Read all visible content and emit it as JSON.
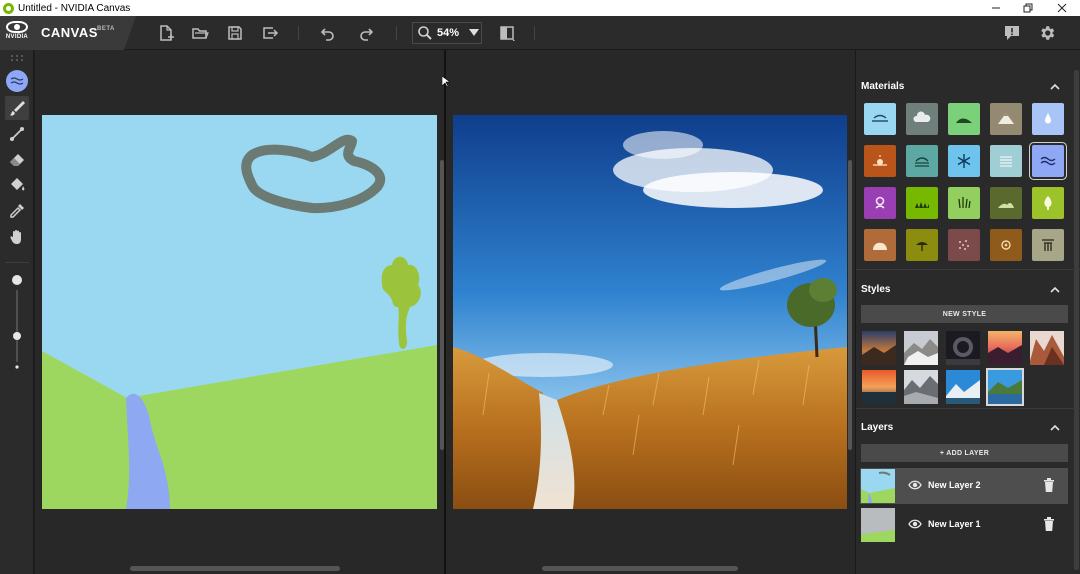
{
  "window": {
    "title": "Untitled - NVIDIA Canvas"
  },
  "brand": {
    "vendor": "NVIDIA",
    "name": "CANVAS",
    "badge": "BETA"
  },
  "toolbar": {
    "zoom_value": "54%",
    "buttons": [
      "new-file-icon",
      "open-folder-icon",
      "save-icon",
      "export-icon",
      "undo-icon",
      "redo-icon"
    ]
  },
  "tools": [
    "paint-bucket-fill-icon",
    "brush-icon",
    "line-icon",
    "eraser-icon",
    "fill-icon",
    "eyedropper-icon",
    "hand-icon"
  ],
  "brush": {
    "size_fraction": 0.25
  },
  "colors": {
    "accent": "#76b900",
    "selected_material": "#8fa8f5",
    "sky": "#9ad8f2",
    "grass": "#9ed75f",
    "river": "#8ea8f2",
    "cloud": "#6b7a72",
    "tree": "#9bc43c"
  },
  "materials": {
    "title": "Materials",
    "items": [
      {
        "name": "sky",
        "color": "#9ad8f2"
      },
      {
        "name": "cloud",
        "color": "#6e7f7c"
      },
      {
        "name": "grass-hill",
        "color": "#7bd07a"
      },
      {
        "name": "mountain",
        "color": "#948a72"
      },
      {
        "name": "water",
        "color": "#a9c4f7"
      },
      {
        "name": "sunset",
        "color": "#b9541b"
      },
      {
        "name": "fog",
        "color": "#5ea8a4"
      },
      {
        "name": "snow",
        "color": "#6ec4ec"
      },
      {
        "name": "sea",
        "color": "#9fcfd4"
      },
      {
        "name": "river",
        "color": "#8fa8f5"
      },
      {
        "name": "flower",
        "color": "#9a3fb3"
      },
      {
        "name": "grass",
        "color": "#76b900"
      },
      {
        "name": "tall-grass",
        "color": "#93cf5e"
      },
      {
        "name": "hill",
        "color": "#5a6a2f"
      },
      {
        "name": "tree",
        "color": "#9cc32a"
      },
      {
        "name": "rock",
        "color": "#b06b3a"
      },
      {
        "name": "beach",
        "color": "#8c8c0f"
      },
      {
        "name": "gravel",
        "color": "#7c4a4a"
      },
      {
        "name": "dirt",
        "color": "#8f5b1c"
      },
      {
        "name": "building",
        "color": "#a8a688"
      }
    ],
    "selected_index": 9
  },
  "styles": {
    "title": "Styles",
    "new_style_label": "NEW STYLE",
    "selected_index": 8
  },
  "layers": {
    "title": "Layers",
    "add_label": "+ ADD LAYER",
    "items": [
      {
        "name": "New Layer 2",
        "active": true
      },
      {
        "name": "New Layer 1",
        "active": false
      }
    ]
  }
}
